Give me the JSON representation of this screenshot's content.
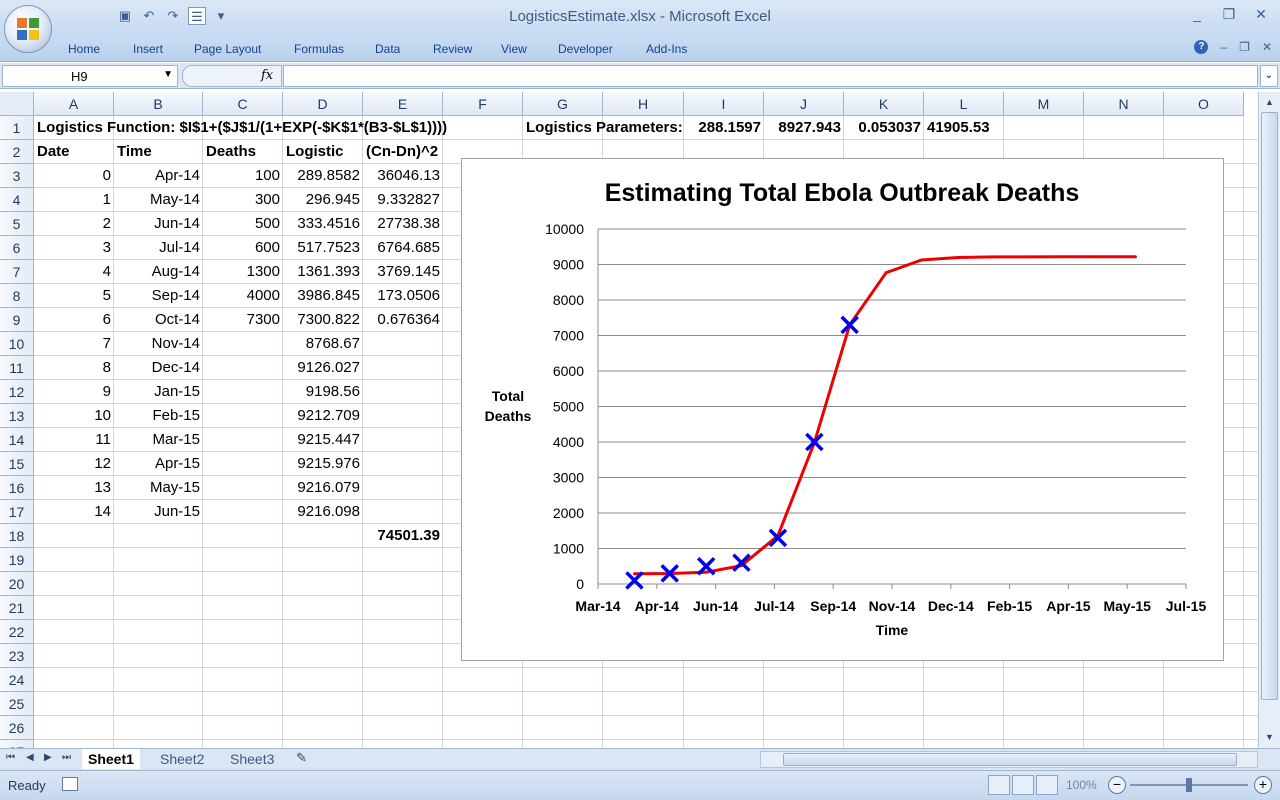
{
  "window": {
    "title": "LogisticsEstimate.xlsx - Microsoft Excel",
    "minimize": "_",
    "restore": "❐",
    "close": "✕"
  },
  "qat": {
    "save_icon": "floppy-icon",
    "undo_icon": "undo-icon",
    "redo_icon": "redo-icon",
    "quickprint_icon": "form-icon"
  },
  "ribbon": {
    "tabs": [
      "Home",
      "Insert",
      "Page Layout",
      "Formulas",
      "Data",
      "Review",
      "View",
      "Developer",
      "Add-Ins"
    ],
    "help": "?",
    "min": "–",
    "restore": "❐",
    "close": "✕"
  },
  "formula_bar": {
    "name_box": "H9",
    "fx": "fx",
    "formula": ""
  },
  "grid": {
    "columns": [
      "A",
      "B",
      "C",
      "D",
      "E",
      "F",
      "G",
      "H",
      "I",
      "J",
      "K",
      "L",
      "M",
      "N",
      "O"
    ],
    "rows": [
      "1",
      "2",
      "3",
      "4",
      "5",
      "6",
      "7",
      "8",
      "9",
      "10",
      "11",
      "12",
      "13",
      "14",
      "15",
      "16",
      "17",
      "18",
      "19",
      "20",
      "21",
      "22",
      "23",
      "24",
      "25",
      "26",
      "27"
    ]
  },
  "cells": {
    "r1": {
      "function_label": "Logistics Function: $I$1+($J$1/(1+EXP(-$K$1*(B3-$L$1))))",
      "params_label": "Logistics Parameters:",
      "I1": "288.1597",
      "J1": "8927.943",
      "K1": "0.053037",
      "L1": "41905.53"
    },
    "headers": {
      "A2": "Date",
      "B2": "Time",
      "C2": "Deaths",
      "D2": "Logistic",
      "E2": "(Cn-Dn)^2"
    },
    "rows": [
      {
        "A": "0",
        "B": "Apr-14",
        "C": "100",
        "D": "289.8582",
        "E": "36046.13"
      },
      {
        "A": "1",
        "B": "May-14",
        "C": "300",
        "D": "296.945",
        "E": "9.332827"
      },
      {
        "A": "2",
        "B": "Jun-14",
        "C": "500",
        "D": "333.4516",
        "E": "27738.38"
      },
      {
        "A": "3",
        "B": "Jul-14",
        "C": "600",
        "D": "517.7523",
        "E": "6764.685"
      },
      {
        "A": "4",
        "B": "Aug-14",
        "C": "1300",
        "D": "1361.393",
        "E": "3769.145"
      },
      {
        "A": "5",
        "B": "Sep-14",
        "C": "4000",
        "D": "3986.845",
        "E": "173.0506"
      },
      {
        "A": "6",
        "B": "Oct-14",
        "C": "7300",
        "D": "7300.822",
        "E": "0.676364"
      },
      {
        "A": "7",
        "B": "Nov-14",
        "C": "",
        "D": "8768.67",
        "E": ""
      },
      {
        "A": "8",
        "B": "Dec-14",
        "C": "",
        "D": "9126.027",
        "E": ""
      },
      {
        "A": "9",
        "B": "Jan-15",
        "C": "",
        "D": "9198.56",
        "E": ""
      },
      {
        "A": "10",
        "B": "Feb-15",
        "C": "",
        "D": "9212.709",
        "E": ""
      },
      {
        "A": "11",
        "B": "Mar-15",
        "C": "",
        "D": "9215.447",
        "E": ""
      },
      {
        "A": "12",
        "B": "Apr-15",
        "C": "",
        "D": "9215.976",
        "E": ""
      },
      {
        "A": "13",
        "B": "May-15",
        "C": "",
        "D": "9216.079",
        "E": ""
      },
      {
        "A": "14",
        "B": "Jun-15",
        "C": "",
        "D": "9216.098",
        "E": ""
      }
    ],
    "E18": "74501.39"
  },
  "chart_data": {
    "type": "scatter",
    "title": "Estimating Total Ebola Outbreak Deaths",
    "xlabel": "Time",
    "ylabel": "Total Deaths",
    "x_ticks": [
      "Mar-14",
      "Apr-14",
      "Jun-14",
      "Jul-14",
      "Sep-14",
      "Nov-14",
      "Dec-14",
      "Feb-15",
      "Apr-15",
      "May-15",
      "Jul-15"
    ],
    "x_tick_dates": [
      "2014-03-01",
      "2014-04-20",
      "2014-06-09",
      "2014-07-29",
      "2014-09-17",
      "2014-11-06",
      "2014-12-26",
      "2015-02-14",
      "2015-04-05",
      "2015-05-25",
      "2015-07-14"
    ],
    "ylim": [
      0,
      10000
    ],
    "y_ticks": [
      0,
      1000,
      2000,
      3000,
      4000,
      5000,
      6000,
      7000,
      8000,
      9000,
      10000
    ],
    "grid": true,
    "series": [
      {
        "style": "markers",
        "marker": "x",
        "color": "#0000ee",
        "x": [
          "2014-04-01",
          "2014-05-01",
          "2014-06-01",
          "2014-07-01",
          "2014-08-01",
          "2014-09-01",
          "2014-10-01"
        ],
        "y": [
          100,
          300,
          500,
          600,
          1300,
          4000,
          7300
        ]
      },
      {
        "style": "line",
        "color": "#ee0000",
        "x": [
          "2014-04-01",
          "2014-05-01",
          "2014-06-01",
          "2014-07-01",
          "2014-08-01",
          "2014-09-01",
          "2014-10-01",
          "2014-11-01",
          "2014-12-01",
          "2015-01-01",
          "2015-02-01",
          "2015-03-01",
          "2015-04-01",
          "2015-05-01",
          "2015-06-01"
        ],
        "y": [
          289.8582,
          296.945,
          333.4516,
          517.7523,
          1361.393,
          3986.845,
          7300.822,
          8768.67,
          9126.027,
          9198.56,
          9212.709,
          9215.447,
          9215.976,
          9216.079,
          9216.098
        ]
      }
    ]
  },
  "sheet_tabs": [
    "Sheet1",
    "Sheet2",
    "Sheet3"
  ],
  "status": {
    "ready": "Ready",
    "zoom": "100%",
    "zoom_out": "−",
    "zoom_in": "+"
  }
}
